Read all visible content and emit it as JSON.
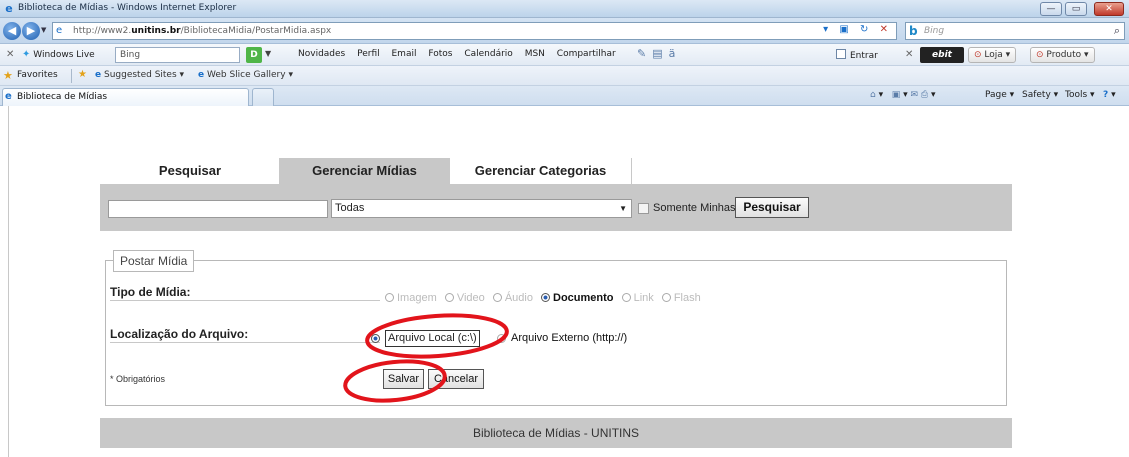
{
  "window": {
    "title": "Biblioteca de Mídias - Windows Internet Explorer",
    "controls": [
      "minimize",
      "maximize",
      "close"
    ]
  },
  "address": {
    "url_prefix": "http://www2.",
    "url_domain": "unitins.br",
    "url_path": "/BibliotecaMidia/PostarMidia.aspx",
    "search_placeholder": "Bing"
  },
  "live_toolbar": {
    "brand": "Windows Live",
    "search_value": "Bing",
    "links": [
      "Novidades",
      "Perfil",
      "Email",
      "Fotos",
      "Calendário",
      "MSN",
      "Compartilhar"
    ],
    "entrar": "Entrar",
    "ebit": "ebit",
    "loja": "Loja",
    "produto": "Produto"
  },
  "favorites_bar": {
    "favorites": "Favorites",
    "suggested_sites": "Suggested Sites ▾",
    "web_slice_gallery": "Web Slice Gallery ▾"
  },
  "tab_bar": {
    "active_tab": "Biblioteca de Mídias",
    "commands": [
      "Page ▾",
      "Safety ▾",
      "Tools ▾"
    ]
  },
  "nav_tabs": [
    "Pesquisar",
    "Gerenciar Mídias",
    "Gerenciar Categorias"
  ],
  "filter": {
    "search_value": "",
    "category_selected": "Todas",
    "somente_minhas": "Somente Minhas",
    "pesquisar_button": "Pesquisar"
  },
  "form": {
    "legend": "Postar Mídia",
    "tipo_label": "Tipo de Mídia:",
    "tipo_options": [
      {
        "label": "Imagem",
        "selected": false
      },
      {
        "label": "Video",
        "selected": false
      },
      {
        "label": "Áudio",
        "selected": false
      },
      {
        "label": "Documento",
        "selected": true
      },
      {
        "label": "Link",
        "selected": false
      },
      {
        "label": "Flash",
        "selected": false
      }
    ],
    "localizacao_label": "Localização do Arquivo:",
    "local_option": "Arquivo Local (c:\\)",
    "externo_option": "Arquivo Externo (http://)",
    "obrigatorios": "* Obrigatórios",
    "salvar_button": "Salvar",
    "cancelar_button": "Cancelar"
  },
  "footer": "Biblioteca de Mídias - UNITINS",
  "colors": {
    "annotation_red": "#e2141b",
    "panel_gray": "#c8c8c8",
    "active_tab_gray": "#c8c8c8"
  }
}
